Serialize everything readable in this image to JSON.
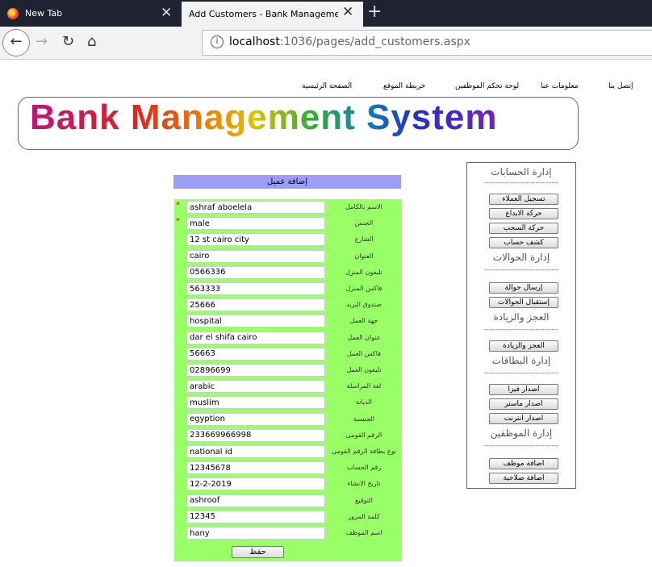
{
  "browser": {
    "tabs": [
      {
        "title": "New Tab"
      },
      {
        "title": "Add Customers - Bank Management Syste"
      }
    ],
    "url_host": "localhost",
    "url_rest": ":1036/pages/add_customers.aspx"
  },
  "top_menu": [
    "الصفحة الرئيسية",
    "خريطة الموقع",
    "لوحة تحكم الموظفين",
    "معلومات عنا",
    "إتصل بنا"
  ],
  "banner_title": "Bank Management System",
  "form": {
    "title": "إضافة عميل",
    "fields": [
      {
        "label": "الاسم بالكامل",
        "value": "ashraf aboelela",
        "required": true
      },
      {
        "label": "الجنس",
        "value": "male",
        "required": true
      },
      {
        "label": "الشارع",
        "value": "12 st cairo city"
      },
      {
        "label": "العنوان",
        "value": "cairo"
      },
      {
        "label": "تليفون المنزل",
        "value": "0566336"
      },
      {
        "label": "فاكس المنزل",
        "value": "563333"
      },
      {
        "label": "صندوق البريد",
        "value": "25666"
      },
      {
        "label": "جهة العمل",
        "value": "hospital"
      },
      {
        "label": "عنوان العمل",
        "value": "dar el shifa cairo"
      },
      {
        "label": "فاكس العمل",
        "value": "56663"
      },
      {
        "label": "تليفون العمل",
        "value": "02896699"
      },
      {
        "label": "لغة المراسلة",
        "value": "arabic"
      },
      {
        "label": "الديانة",
        "value": "muslim"
      },
      {
        "label": "الجنسية",
        "value": "egyption"
      },
      {
        "label": "الرقم القومى",
        "value": "233669966998"
      },
      {
        "label": "نوع بطاقة الرقم القومى",
        "value": "national id"
      },
      {
        "label": "رقم الحساب",
        "value": "12345678"
      },
      {
        "label": "تاريخ الانشاء",
        "value": "12-2-2019"
      },
      {
        "label": "التوقيع",
        "value": "ashroof"
      },
      {
        "label": "كلمة المرور",
        "value": "12345"
      },
      {
        "label": "اسم الموظف",
        "value": "hany"
      }
    ],
    "save_label": "حفظ"
  },
  "sidebar": {
    "separator": "--------------------------------",
    "sections": [
      {
        "heading": "إدارة الحسابات",
        "buttons": [
          "تسجيل العملاء",
          "حركة الايداع",
          "حركة السحب",
          "كشف حساب"
        ]
      },
      {
        "heading": "إدارة الحوالات",
        "buttons": [
          "إرسال حوالة",
          "إستقبال الحوالات"
        ]
      },
      {
        "heading": "العجز والزيادة",
        "buttons": [
          "العجز والزيادة"
        ]
      },
      {
        "heading": "إدارة البطاقات",
        "buttons": [
          "اصدار فيزا",
          "اصدار ماستر",
          "اصدار انترنت"
        ]
      },
      {
        "heading": "إدارة الموظفين",
        "buttons": [
          "اضافة موظف",
          "اضافة صلاحية"
        ]
      }
    ]
  }
}
